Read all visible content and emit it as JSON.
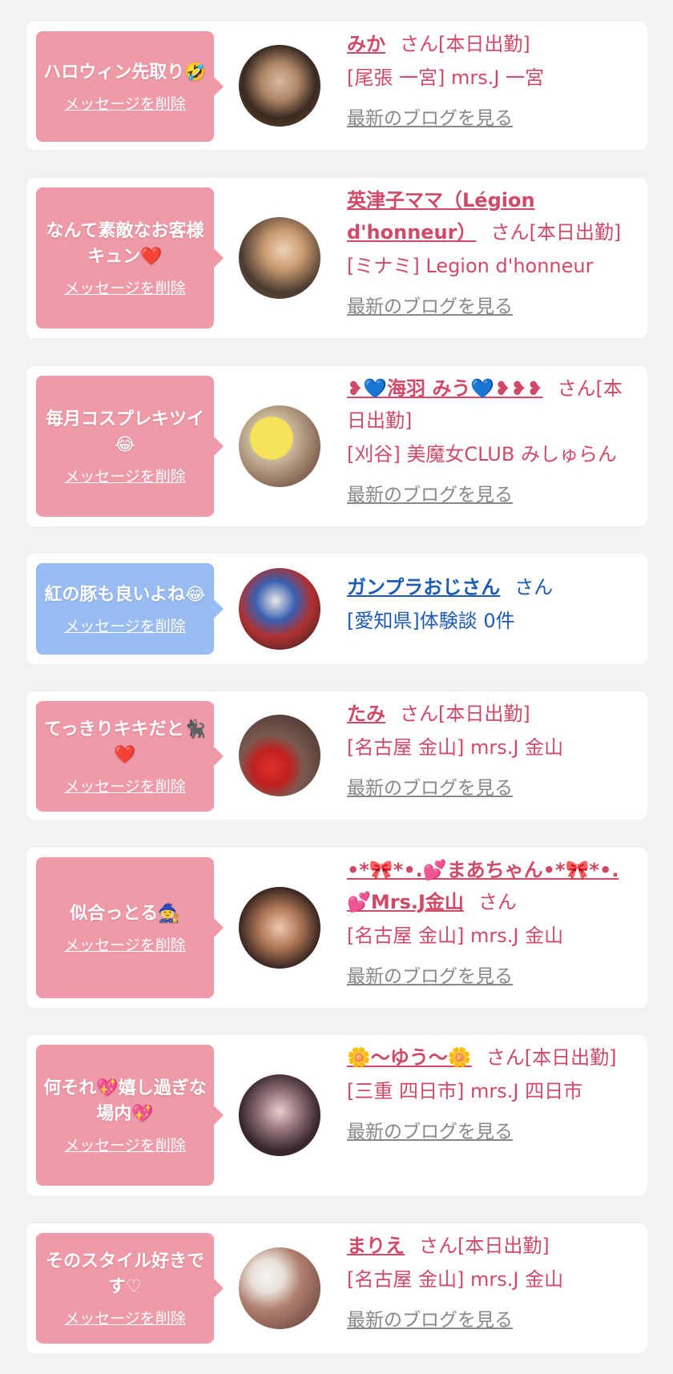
{
  "delete_label": "メッセージを削除",
  "blog_label": "最新のブログを見る",
  "san_label": "さん",
  "cards": [
    {
      "message": "ハロウィン先取り🤣",
      "name": "みか",
      "suffix": "さん[本日出勤]",
      "store": "[尾張 一宮] mrs.J 一宮",
      "blog": "最新のブログを見る"
    },
    {
      "message": "なんて素敵なお客様キュン❤️",
      "name": "英津子ママ（Légion d'honneur）",
      "suffix": "さん[本日出勤]",
      "store": "[ミナミ] Legion d'honneur",
      "blog": "最新のブログを見る"
    },
    {
      "message": "毎月コスプレキツイ😂",
      "name": "❥💙海羽 みう💙❥❥❥",
      "suffix": "さん[本日出勤]",
      "store": "[刈谷] 美魔女CLUB みしゅらん",
      "blog": "最新のブログを見る"
    },
    {
      "message": "紅の豚も良いよね😂",
      "name": "ガンプラおじさん",
      "suffix": "さん",
      "store": "[愛知県]体験談 0件",
      "blog": ""
    },
    {
      "message": "てっきりキキだと🐈‍⬛❤️",
      "name": "たみ",
      "suffix": "さん[本日出勤]",
      "store": "[名古屋 金山] mrs.J 金山",
      "blog": "最新のブログを見る"
    },
    {
      "message": "似合っとる🧙",
      "name": "•*🎀*•.💕まあちゃん•*🎀*•.💕Mrs.J金山",
      "suffix": "さん",
      "store": "[名古屋 金山] mrs.J 金山",
      "blog": "最新のブログを見る"
    },
    {
      "message": "何それ💖嬉し過ぎな場内💖",
      "name": "🌼〜ゆう〜🌼",
      "suffix": "さん[本日出勤]",
      "store": "[三重 四日市] mrs.J 四日市",
      "blog": "最新のブログを見る"
    },
    {
      "message": "そのスタイル好きです♡",
      "name": "まりえ",
      "suffix": "さん[本日出勤]",
      "store": "[名古屋 金山] mrs.J 金山",
      "blog": "最新のブログを見る"
    }
  ],
  "colors": {
    "pink_bubble": "#ef9aa8",
    "blue_bubble": "#99bcf2",
    "pink_text": "#d04a68",
    "blue_text": "#1d5bb5",
    "gray_link": "#888888"
  }
}
